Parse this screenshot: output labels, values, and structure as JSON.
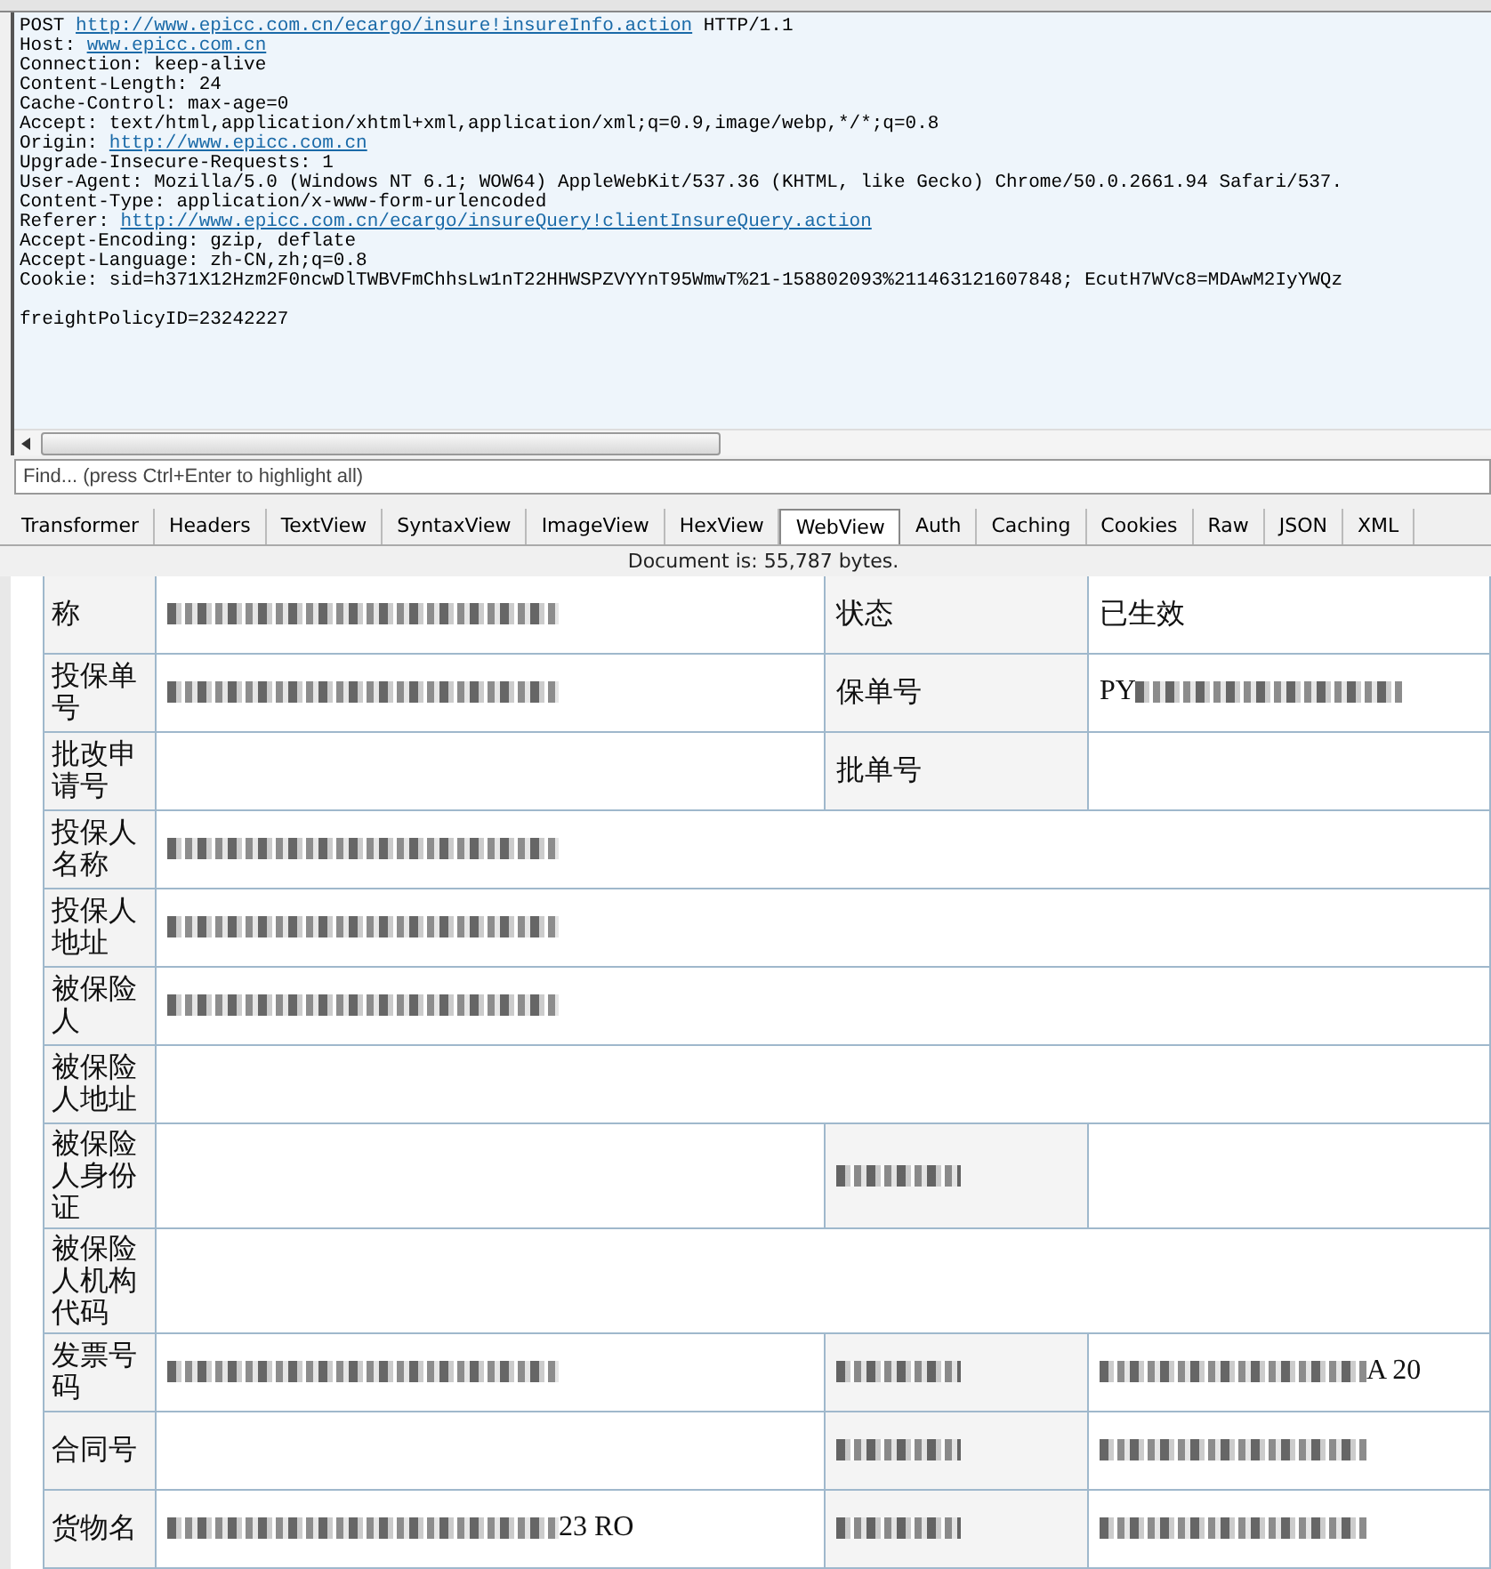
{
  "request": {
    "lines": [
      [
        {
          "text": "POST ",
          "link": false
        },
        {
          "text": "http://www.epicc.com.cn/ecargo/insure!insureInfo.action",
          "link": true
        },
        {
          "text": " HTTP/1.1",
          "link": false
        }
      ],
      [
        {
          "text": "Host: ",
          "link": false
        },
        {
          "text": "www.epicc.com.cn",
          "link": true
        }
      ],
      [
        {
          "text": "Connection: keep-alive",
          "link": false
        }
      ],
      [
        {
          "text": "Content-Length: 24",
          "link": false
        }
      ],
      [
        {
          "text": "Cache-Control: max-age=0",
          "link": false
        }
      ],
      [
        {
          "text": "Accept: text/html,application/xhtml+xml,application/xml;q=0.9,image/webp,*/*;q=0.8",
          "link": false
        }
      ],
      [
        {
          "text": "Origin: ",
          "link": false
        },
        {
          "text": "http://www.epicc.com.cn",
          "link": true
        }
      ],
      [
        {
          "text": "Upgrade-Insecure-Requests: 1",
          "link": false
        }
      ],
      [
        {
          "text": "User-Agent: Mozilla/5.0 (Windows NT 6.1; WOW64) AppleWebKit/537.36 (KHTML, like Gecko) Chrome/50.0.2661.94 Safari/537.",
          "link": false
        }
      ],
      [
        {
          "text": "Content-Type: application/x-www-form-urlencoded",
          "link": false
        }
      ],
      [
        {
          "text": "Referer: ",
          "link": false
        },
        {
          "text": "http://www.epicc.com.cn/ecargo/insureQuery!clientInsureQuery.action",
          "link": true
        }
      ],
      [
        {
          "text": "Accept-Encoding: gzip, deflate",
          "link": false
        }
      ],
      [
        {
          "text": "Accept-Language: zh-CN,zh;q=0.8",
          "link": false
        }
      ],
      [
        {
          "text": "Cookie: sid=h371X12Hzm2F0ncwDlTWBVFmChhsLw1nT22HHWSPZVYYnT95WmwT%21-158802093%211463121607848; EcutH7WVc8=MDAwM2IyYWQz",
          "link": false
        }
      ],
      {
        "kind": "blank"
      },
      [
        {
          "text": "freightPolicyID=23242227",
          "link": false
        }
      ]
    ]
  },
  "find": {
    "placeholder": "Find... (press Ctrl+Enter to highlight all)"
  },
  "tabs": [
    {
      "label": "Transformer",
      "selected": false
    },
    {
      "label": "Headers",
      "selected": false
    },
    {
      "label": "TextView",
      "selected": false
    },
    {
      "label": "SyntaxView",
      "selected": false
    },
    {
      "label": "ImageView",
      "selected": false
    },
    {
      "label": "HexView",
      "selected": false
    },
    {
      "label": "WebView",
      "selected": true
    },
    {
      "label": "Auth",
      "selected": false
    },
    {
      "label": "Caching",
      "selected": false
    },
    {
      "label": "Cookies",
      "selected": false
    },
    {
      "label": "Raw",
      "selected": false
    },
    {
      "label": "JSON",
      "selected": false
    },
    {
      "label": "XML",
      "selected": false
    }
  ],
  "document_info": "Document is: 55,787 bytes.",
  "table": {
    "rows": [
      {
        "label": "称",
        "value": {
          "kind": "blurred"
        },
        "label2": {
          "kind": "text",
          "text": "状态"
        },
        "value2": {
          "kind": "text",
          "text": "已生效"
        }
      },
      {
        "label": "投保单号",
        "value": {
          "kind": "blurred"
        },
        "label2": {
          "kind": "text",
          "text": "保单号"
        },
        "value2": {
          "kind": "blurred",
          "prefix": "PY"
        }
      },
      {
        "label": "批改申请号",
        "value": {
          "kind": "empty"
        },
        "label2": {
          "kind": "text",
          "text": "批单号"
        },
        "value2": {
          "kind": "empty"
        }
      },
      {
        "label": "投保人名称",
        "value": {
          "kind": "blurred"
        }
      },
      {
        "label": "投保人地址",
        "value": {
          "kind": "blurred"
        }
      },
      {
        "label": "被保险人",
        "value": {
          "kind": "blurred"
        }
      },
      {
        "label": "被保险人地址",
        "value": {
          "kind": "empty"
        }
      },
      {
        "label": "被保险人身份证",
        "value": {
          "kind": "empty"
        },
        "label2": {
          "kind": "blurred"
        },
        "value2": {
          "kind": "empty"
        }
      },
      {
        "label": "被保险人机构代码",
        "value": {
          "kind": "empty"
        }
      },
      {
        "label": "发票号码",
        "value": {
          "kind": "blurred"
        },
        "label2": {
          "kind": "blurred"
        },
        "value2": {
          "kind": "blurred",
          "suffix": "A 20"
        }
      },
      {
        "label": "合同号",
        "value": {
          "kind": "empty"
        },
        "label2": {
          "kind": "blurred"
        },
        "value2": {
          "kind": "blurred"
        }
      },
      {
        "label": "货物名",
        "value": {
          "kind": "blurred",
          "suffix": "23 RO"
        },
        "label2": {
          "kind": "blurred"
        },
        "value2": {
          "kind": "blurred"
        }
      }
    ]
  }
}
